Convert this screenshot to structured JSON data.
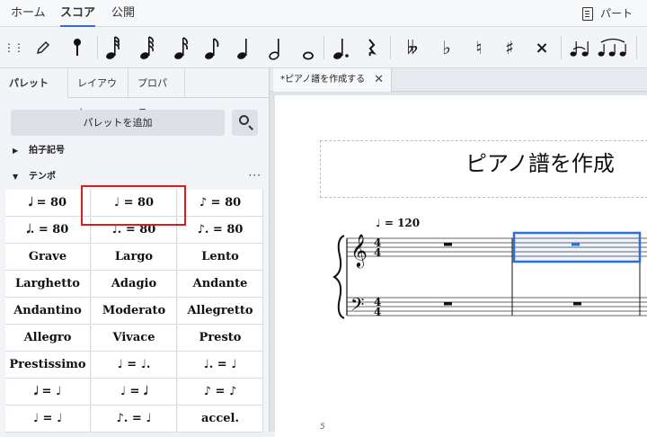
{
  "menu": {
    "tabs": [
      "ホーム",
      "スコア",
      "公開"
    ],
    "active": "スコア",
    "parts_label": "パート"
  },
  "toolbar": {
    "icons": [
      "grip-icon",
      "pencil-icon",
      "accent-pin-icon",
      "64th-note-icon",
      "32nd-note-icon",
      "16th-note-icon",
      "eighth-note-icon",
      "quarter-note-icon",
      "half-note-icon",
      "whole-note-icon",
      "dotted-note-icon",
      "rest-icon",
      "double-flat-icon",
      "flat-icon",
      "natural-icon",
      "sharp-icon",
      "double-sharp-icon",
      "tie-icon",
      "slur-icon"
    ]
  },
  "palette_panel": {
    "tabs": [
      "パレット",
      "レイアウト",
      "プロパティ"
    ],
    "tab_more": "···",
    "add_palette_label": "パレットを追加",
    "sections": [
      {
        "label": "拍子記号",
        "expanded": false
      },
      {
        "label": "テンポ",
        "expanded": true
      }
    ],
    "section_more": "···",
    "tempo_cells": [
      "𝅗𝅥 = 80",
      "♩ = 80",
      "♪ = 80",
      "𝅗𝅥. = 80",
      "♩. = 80",
      "♪. = 80",
      "Grave",
      "Largo",
      "Lento",
      "Larghetto",
      "Adagio",
      "Andante",
      "Andantino",
      "Moderato",
      "Allegretto",
      "Allegro",
      "Vivace",
      "Presto",
      "Prestissimo",
      "♩ = ♩.",
      "♩. = ♩",
      "𝅗𝅥 = ♩",
      "♩ = 𝅗𝅥",
      "♪ = ♪",
      "♩ = ♩",
      "♪. = ♩",
      "accel."
    ]
  },
  "document": {
    "tab_label": "*ピアノ譜を作成する",
    "title": "ピアノ譜を作成",
    "tempo_marking": "♩ = 120",
    "page_number": "5"
  },
  "accent_color": "#2f6fd6",
  "highlight_color": "#d62020"
}
